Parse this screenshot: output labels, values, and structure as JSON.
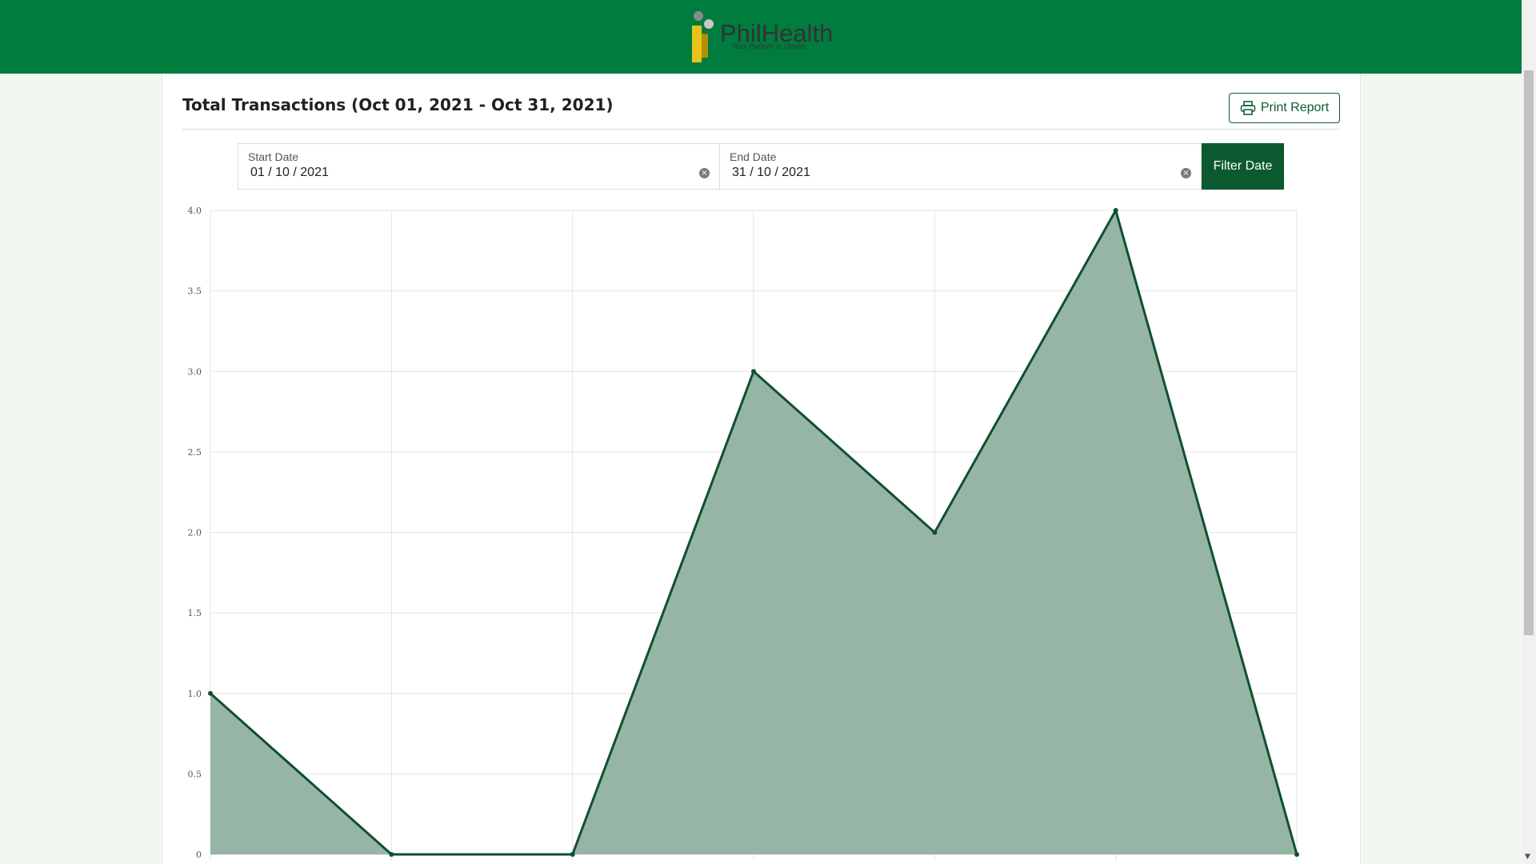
{
  "brand": {
    "name": "PhilHealth",
    "tagline": "Your Partner in Health",
    "colors": {
      "header": "#007c3e",
      "accent": "#0b5a2f",
      "area_fill": "#97b5a5",
      "line": "#0f5031"
    }
  },
  "report": {
    "title": "Total Transactions (Oct 01, 2021 - Oct 31, 2021)",
    "print_label": "Print Report",
    "print_icon": "printer-icon"
  },
  "filters": {
    "start": {
      "label": "Start Date",
      "value": "01 / 10 / 2021"
    },
    "end": {
      "label": "End Date",
      "value": "31 / 10 / 2021"
    },
    "button_label": "Filter Date"
  },
  "chart_data": {
    "type": "area",
    "x": [
      0,
      1,
      2,
      3,
      4,
      5,
      6
    ],
    "values": [
      1,
      0,
      0,
      3,
      2,
      4,
      0
    ],
    "ylim": [
      0,
      4
    ],
    "yticks": [
      "0",
      "0.5",
      "1.0",
      "1.5",
      "2.0",
      "2.5",
      "3.0",
      "3.5",
      "4.0"
    ],
    "grid": true
  }
}
